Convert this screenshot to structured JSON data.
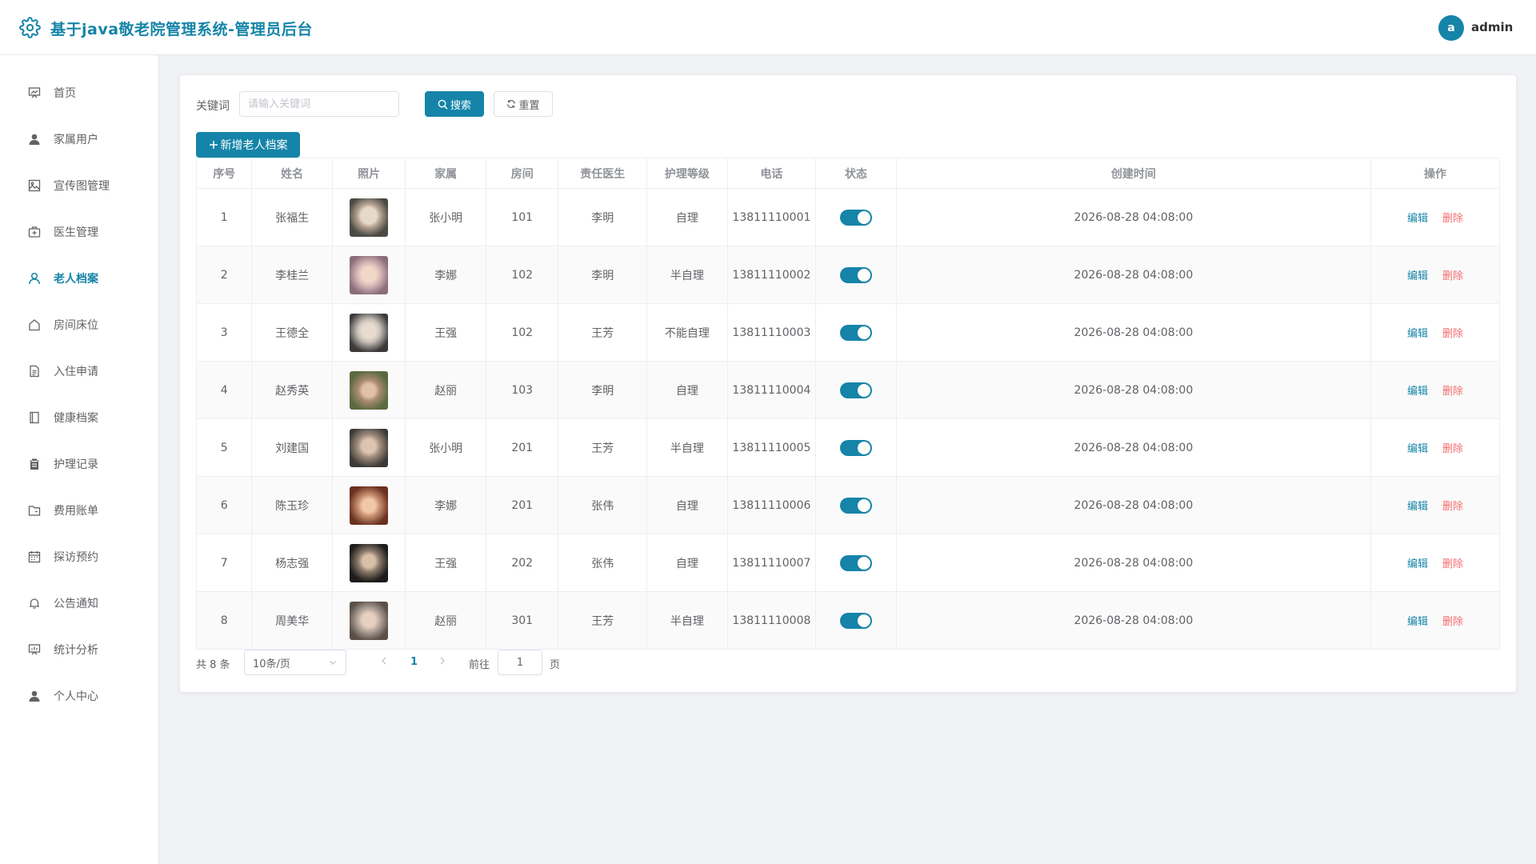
{
  "header": {
    "title": "基于java敬老院管理系统-管理员后台",
    "user_initial": "a",
    "user_name": "admin"
  },
  "sidebar": {
    "items": [
      {
        "label": "首页",
        "icon": "chart-board-icon"
      },
      {
        "label": "家属用户",
        "icon": "user-solid-icon"
      },
      {
        "label": "宣传图管理",
        "icon": "picture-icon"
      },
      {
        "label": "医生管理",
        "icon": "first-aid-icon"
      },
      {
        "label": "老人档案",
        "icon": "user-outline-icon",
        "active": true
      },
      {
        "label": "房间床位",
        "icon": "house-icon"
      },
      {
        "label": "入住申请",
        "icon": "document-icon"
      },
      {
        "label": "健康档案",
        "icon": "notebook-icon"
      },
      {
        "label": "护理记录",
        "icon": "clipboard-icon"
      },
      {
        "label": "费用账单",
        "icon": "folder-icon"
      },
      {
        "label": "探访预约",
        "icon": "calendar-icon"
      },
      {
        "label": "公告通知",
        "icon": "bell-icon"
      },
      {
        "label": "统计分析",
        "icon": "data-board-icon"
      },
      {
        "label": "个人中心",
        "icon": "user-solid-icon"
      }
    ]
  },
  "search": {
    "label": "关键词",
    "placeholder": "请输入关键词",
    "value": "",
    "search_label": "搜索",
    "reset_label": "重置",
    "add_label": "新增老人档案"
  },
  "table": {
    "columns": [
      "序号",
      "姓名",
      "照片",
      "家属",
      "房间",
      "责任医生",
      "护理等级",
      "电话",
      "状态",
      "创建时间",
      "操作"
    ],
    "edit_label": "编辑",
    "delete_label": "删除",
    "rows": [
      {
        "index": "1",
        "name": "张福生",
        "family": "张小明",
        "room": "101",
        "doctor": "李明",
        "level": "自理",
        "phone": "13811110001",
        "status": true,
        "created": "2026-08-28 04:08:00"
      },
      {
        "index": "2",
        "name": "李桂兰",
        "family": "李娜",
        "room": "102",
        "doctor": "李明",
        "level": "半自理",
        "phone": "13811110002",
        "status": true,
        "created": "2026-08-28 04:08:00"
      },
      {
        "index": "3",
        "name": "王德全",
        "family": "王强",
        "room": "102",
        "doctor": "王芳",
        "level": "不能自理",
        "phone": "13811110003",
        "status": true,
        "created": "2026-08-28 04:08:00"
      },
      {
        "index": "4",
        "name": "赵秀英",
        "family": "赵丽",
        "room": "103",
        "doctor": "李明",
        "level": "自理",
        "phone": "13811110004",
        "status": true,
        "created": "2026-08-28 04:08:00"
      },
      {
        "index": "5",
        "name": "刘建国",
        "family": "张小明",
        "room": "201",
        "doctor": "王芳",
        "level": "半自理",
        "phone": "13811110005",
        "status": true,
        "created": "2026-08-28 04:08:00"
      },
      {
        "index": "6",
        "name": "陈玉珍",
        "family": "李娜",
        "room": "201",
        "doctor": "张伟",
        "level": "自理",
        "phone": "13811110006",
        "status": true,
        "created": "2026-08-28 04:08:00"
      },
      {
        "index": "7",
        "name": "杨志强",
        "family": "王强",
        "room": "202",
        "doctor": "张伟",
        "level": "自理",
        "phone": "13811110007",
        "status": true,
        "created": "2026-08-28 04:08:00"
      },
      {
        "index": "8",
        "name": "周美华",
        "family": "赵丽",
        "room": "301",
        "doctor": "王芳",
        "level": "半自理",
        "phone": "13811110008",
        "status": true,
        "created": "2026-08-28 04:08:00"
      }
    ]
  },
  "pagination": {
    "total_text": "共 8 条",
    "page_size": "10条/页",
    "current_page": "1",
    "goto_label": "前往",
    "goto_value": "1",
    "page_unit": "页"
  },
  "colors": {
    "accent": "#1584a8",
    "danger": "#f56c6c",
    "background": "#f0f2f5"
  }
}
